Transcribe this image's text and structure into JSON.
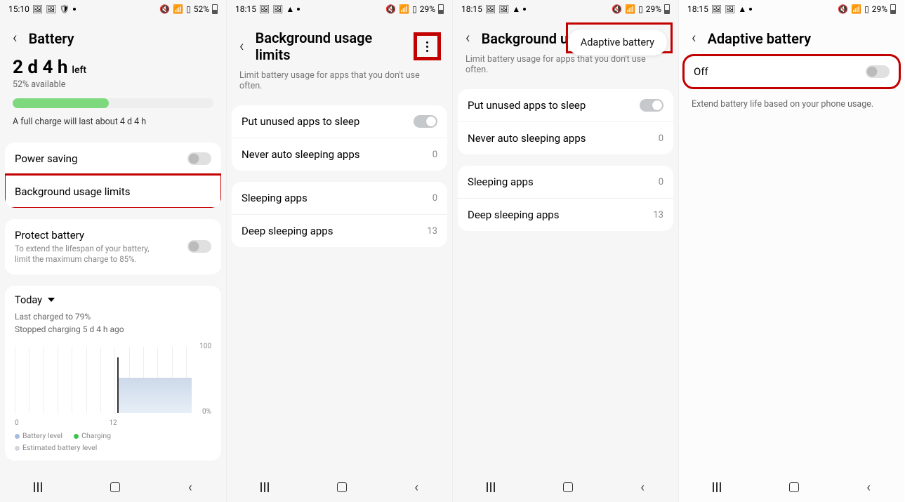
{
  "phones": [
    {
      "status": {
        "time": "15:10",
        "pct": "52%",
        "mute_icon": "🔇"
      },
      "title": "Battery",
      "time_left": "2 d 4 h",
      "left_suffix": "left",
      "available": "52% available",
      "full_note": "A full charge will last about 4 d 4 h",
      "power_saving": "Power saving",
      "bg_limits": "Background usage limits",
      "protect_title": "Protect battery",
      "protect_desc": "To extend the lifespan of your battery, limit the maximum charge to 85%.",
      "today": "Today",
      "last_charged": "Last charged to 79%",
      "stopped": "Stopped charging 5 d 4 h ago",
      "axis": {
        "y_top": "100",
        "y_bot": "0%",
        "x0": "0",
        "x1": "12"
      },
      "legend": {
        "batt": "Battery level",
        "chg": "Charging",
        "est": "Estimated battery level"
      }
    },
    {
      "status": {
        "time": "18:15",
        "pct": "29%",
        "mute_icon": "🔇"
      },
      "title": "Background usage limits",
      "sub": "Limit battery usage for apps that you don't use often.",
      "items": [
        {
          "label": "Put unused apps to sleep"
        },
        {
          "label": "Never auto sleeping apps",
          "count": "0"
        },
        {
          "label": "Sleeping apps",
          "count": "0"
        },
        {
          "label": "Deep sleeping apps",
          "count": "13"
        }
      ]
    },
    {
      "status": {
        "time": "18:15",
        "pct": "29%",
        "mute_icon": "🔇"
      },
      "title": "Background usa",
      "sub": "Limit battery usage for apps that you don't use often.",
      "popup": "Adaptive battery",
      "items": [
        {
          "label": "Put unused apps to sleep"
        },
        {
          "label": "Never auto sleeping apps",
          "count": "0"
        },
        {
          "label": "Sleeping apps",
          "count": "0"
        },
        {
          "label": "Deep sleeping apps",
          "count": "13"
        }
      ]
    },
    {
      "status": {
        "time": "18:15",
        "pct": "29%",
        "mute_icon": "🔇"
      },
      "title": "Adaptive battery",
      "off_label": "Off",
      "extend": "Extend battery life based on your phone usage."
    }
  ],
  "status_icons": {
    "warn": "▲",
    "alert": "!"
  }
}
